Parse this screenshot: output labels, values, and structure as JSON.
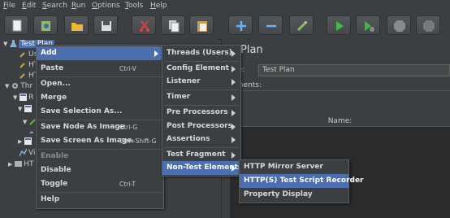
{
  "menubar": {
    "items": [
      "File",
      "Edit",
      "Search",
      "Run",
      "Options",
      "Tools",
      "Help"
    ]
  },
  "toolbar": {
    "buttons": [
      "new-icon",
      "templates-icon",
      "open-icon",
      "save-icon",
      "cut-icon",
      "copy-icon",
      "paste-icon",
      "expand-icon",
      "collapse-icon",
      "toggle-icon",
      "start-icon",
      "start-no-pause-icon",
      "stop-icon",
      "shutdown-icon"
    ]
  },
  "tree": {
    "items": [
      "Test Plan",
      "Us",
      "HT",
      "HT",
      "Thr",
      "R",
      "",
      "",
      "",
      "Vie",
      "HT"
    ]
  },
  "right_panel": {
    "title": "est Plan",
    "name_label": "me:",
    "name_value": "Test Plan",
    "comments_label": "mments:",
    "table_header": "Name:"
  },
  "context_menu": {
    "items": [
      {
        "label": "Add",
        "shortcut": ""
      },
      {
        "label": "Paste",
        "shortcut": "Ctrl-V"
      },
      {
        "label": "Open...",
        "shortcut": ""
      },
      {
        "label": "Merge",
        "shortcut": ""
      },
      {
        "label": "Save Selection As...",
        "shortcut": ""
      },
      {
        "label": "Save Node As Image",
        "shortcut": "Ctrl-G"
      },
      {
        "label": "Save Screen As Image",
        "shortcut": "Ctrl+Shift-G"
      },
      {
        "label": "Enable",
        "shortcut": ""
      },
      {
        "label": "Disable",
        "shortcut": ""
      },
      {
        "label": "Toggle",
        "shortcut": "Ctrl-T"
      },
      {
        "label": "Help",
        "shortcut": ""
      }
    ]
  },
  "add_submenu": {
    "items": [
      "Threads (Users)",
      "Config Element",
      "Listener",
      "Timer",
      "Pre Processors",
      "Post Processors",
      "Assertions",
      "Test Fragment",
      "Non-Test Elements"
    ]
  },
  "nontest_submenu": {
    "items": [
      "HTTP Mirror Server",
      "HTTP(S) Test Script Recorder",
      "Property Display"
    ]
  },
  "colors": {
    "background": "#3c3f41",
    "selection": "#4b6eaf",
    "text": "#d8d8d8"
  }
}
